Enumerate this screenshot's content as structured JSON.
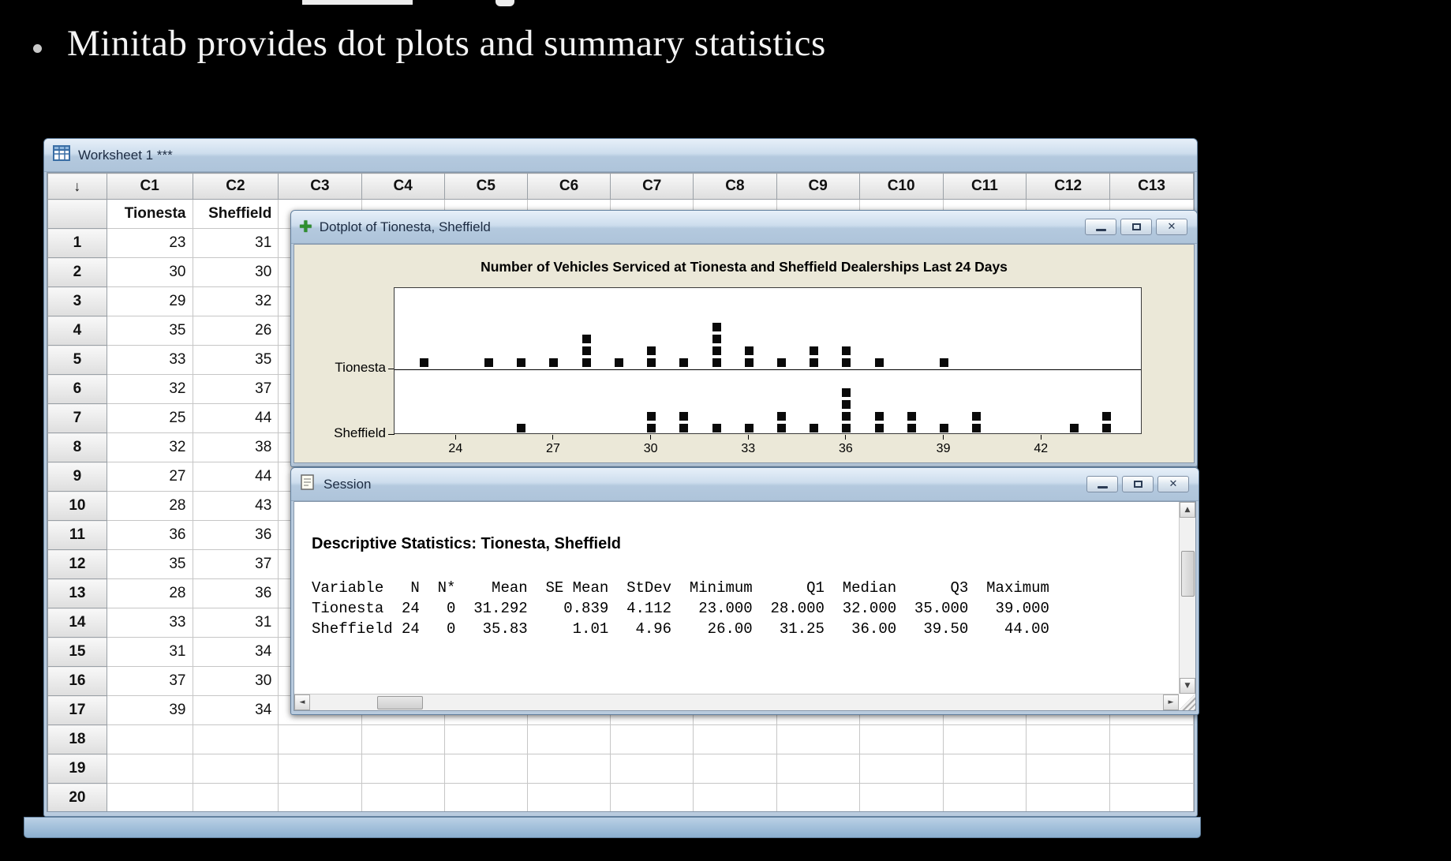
{
  "slide": {
    "bullet_text": "Minitab provides dot plots and summary statistics"
  },
  "worksheet": {
    "title": "Worksheet 1 ***",
    "corner_label": "↓",
    "columns": [
      "C1",
      "C2",
      "C3",
      "C4",
      "C5",
      "C6",
      "C7",
      "C8",
      "C9",
      "C10",
      "C11",
      "C12",
      "C13"
    ],
    "variable_names": {
      "C1": "Tionesta",
      "C2": "Sheffield"
    },
    "rows": [
      [
        23,
        31
      ],
      [
        30,
        30
      ],
      [
        29,
        32
      ],
      [
        35,
        26
      ],
      [
        33,
        35
      ],
      [
        32,
        37
      ],
      [
        25,
        44
      ],
      [
        32,
        38
      ],
      [
        27,
        44
      ],
      [
        28,
        43
      ],
      [
        36,
        36
      ],
      [
        35,
        37
      ],
      [
        28,
        36
      ],
      [
        33,
        31
      ],
      [
        31,
        34
      ],
      [
        37,
        30
      ],
      [
        39,
        34
      ]
    ]
  },
  "dotplot_window": {
    "title": "Dotplot of Tionesta, Sheffield",
    "buttons": [
      "minimize",
      "restore",
      "close"
    ]
  },
  "chart_data": {
    "type": "dotplot",
    "title": "Number of Vehicles Serviced at Tionesta and Sheffield Dealerships Last 24 Days",
    "x_ticks": [
      24,
      27,
      30,
      33,
      36,
      39,
      42
    ],
    "x_range": [
      22.1,
      45.1
    ],
    "legend": "none",
    "series": [
      {
        "name": "Tionesta",
        "values": [
          23,
          25,
          26,
          27,
          28,
          28,
          28,
          29,
          30,
          30,
          31,
          32,
          32,
          32,
          32,
          33,
          33,
          34,
          35,
          35,
          36,
          36,
          37,
          39
        ]
      },
      {
        "name": "Sheffield",
        "values": [
          26,
          30,
          30,
          31,
          31,
          32,
          33,
          34,
          34,
          35,
          36,
          36,
          36,
          36,
          37,
          37,
          38,
          38,
          39,
          40,
          40,
          43,
          44,
          44
        ]
      }
    ]
  },
  "session_window": {
    "title": "Session",
    "heading": "Descriptive Statistics: Tionesta, Sheffield",
    "buttons": [
      "minimize",
      "restore",
      "close"
    ],
    "stats_table": {
      "headers": [
        "Variable",
        "N",
        "N*",
        "Mean",
        "SE Mean",
        "StDev",
        "Minimum",
        "Q1",
        "Median",
        "Q3",
        "Maximum"
      ],
      "rows": [
        [
          "Tionesta",
          "24",
          "0",
          "31.292",
          "0.839",
          "4.112",
          "23.000",
          "28.000",
          "32.000",
          "35.000",
          "39.000"
        ],
        [
          "Sheffield",
          "24",
          "0",
          "35.83",
          "1.01",
          "4.96",
          "26.00",
          "31.25",
          "36.00",
          "39.50",
          "44.00"
        ]
      ]
    },
    "stats_lines": [
      "Variable   N  N*    Mean  SE Mean  StDev  Minimum      Q1  Median      Q3  Maximum",
      "Tionesta  24   0  31.292    0.839  4.112   23.000  28.000  32.000  35.000   39.000",
      "Sheffield 24   0   35.83     1.01   4.96    26.00   31.25   36.00   39.50    44.00"
    ]
  }
}
